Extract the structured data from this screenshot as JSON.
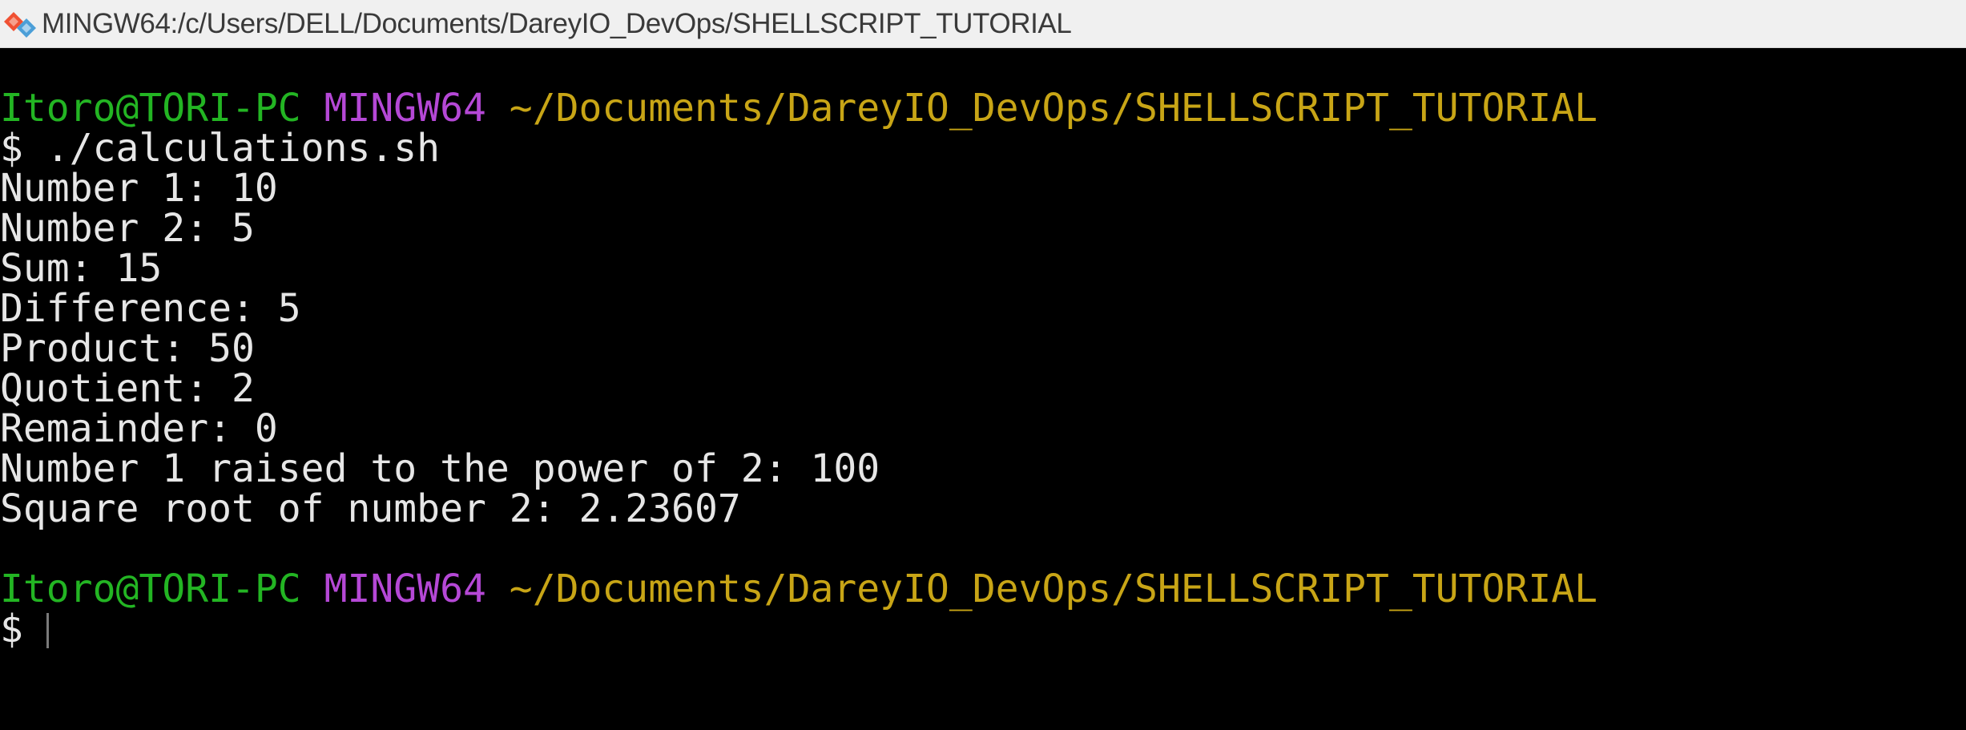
{
  "window": {
    "title": "MINGW64:/c/Users/DELL/Documents/DareyIO_DevOps/SHELLSCRIPT_TUTORIAL",
    "icon": "git-bash-icon"
  },
  "terminal": {
    "prompt1": {
      "user": "Itoro@TORI-PC",
      "host": "MINGW64",
      "path": "~/Documents/DareyIO_DevOps/SHELLSCRIPT_TUTORIAL"
    },
    "command1": "$ ./calculations.sh",
    "output": [
      "Number 1: 10",
      "Number 2: 5",
      "Sum: 15",
      "Difference: 5",
      "Product: 50",
      "Quotient: 2",
      "Remainder: 0",
      "Number 1 raised to the power of 2: 100",
      "Square root of number 2: 2.23607"
    ],
    "prompt2": {
      "user": "Itoro@TORI-PC",
      "host": "MINGW64",
      "path": "~/Documents/DareyIO_DevOps/SHELLSCRIPT_TUTORIAL"
    },
    "prompt_symbol": "$ "
  },
  "colors": {
    "background": "#000000",
    "text": "#e6e6e6",
    "user": "#23b523",
    "host": "#b548d6",
    "path": "#c8a516"
  }
}
